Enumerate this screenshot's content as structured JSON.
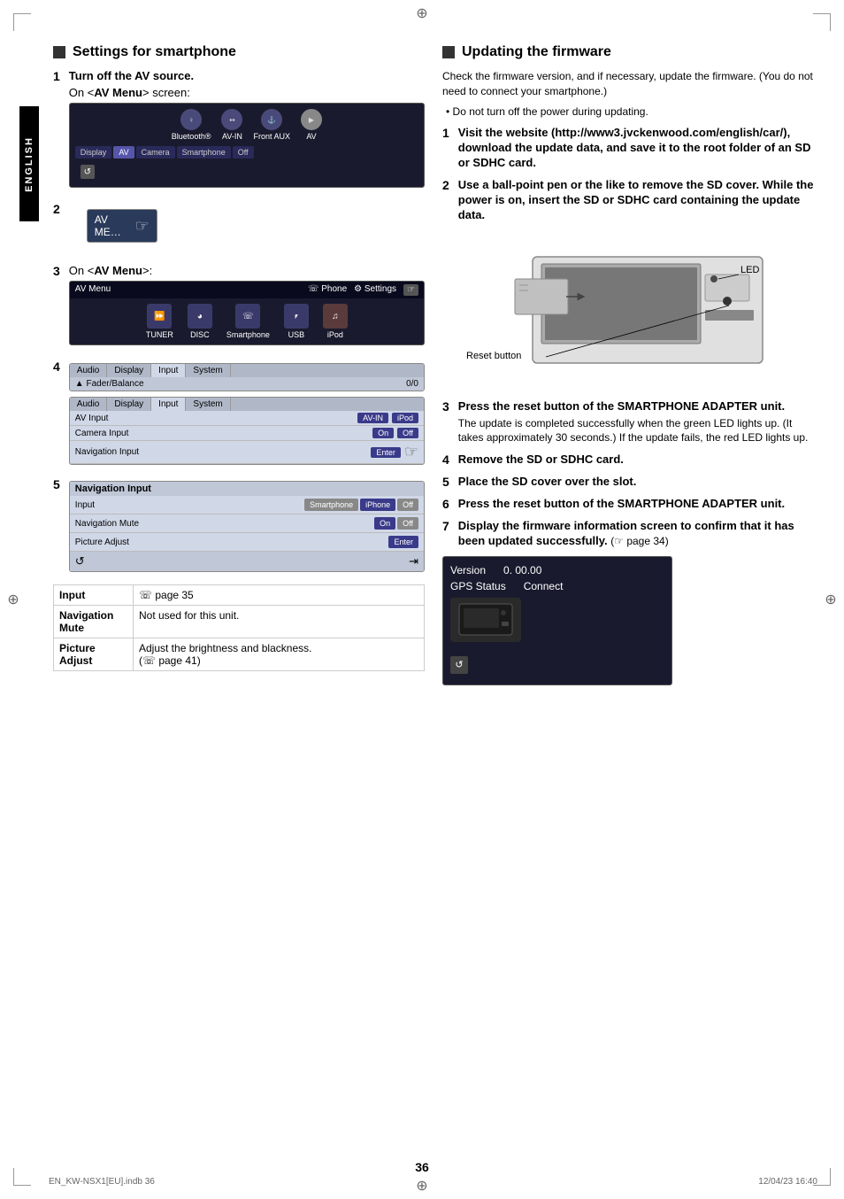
{
  "page": {
    "number": "36",
    "footer_left": "EN_KW-NSX1[EU].indb   36",
    "footer_right": "12/04/23   16:40",
    "language": "ENGLISH"
  },
  "left_section": {
    "title": "Settings for smartphone",
    "step1": {
      "num": "1",
      "text": "Turn off the AV source.",
      "sub": "On <AV Menu> screen:"
    },
    "step2": {
      "num": "2"
    },
    "step3": {
      "num": "3",
      "text": "On <AV Menu>:"
    },
    "step4": {
      "num": "4"
    },
    "step5": {
      "num": "5"
    },
    "av_source_screen": {
      "icons": [
        "Bluetooth®",
        "AV-IN",
        "Front AUX",
        "AV"
      ],
      "tabs": [
        "Display",
        "AV",
        "Camera",
        "Smartphone",
        "Off"
      ],
      "active_tab": "AV"
    },
    "av_menu_button": "AV ME…",
    "av_menu_screen": {
      "title": "AV Menu",
      "phone_label": "Phone",
      "settings_label": "Settings",
      "items": [
        "TUNER",
        "DISC",
        "Smartphone",
        "USB",
        "iPod"
      ]
    },
    "settings_screen1": {
      "tabs": [
        "Audio",
        "Display",
        "Input",
        "System"
      ],
      "header_label": "Fader/Balance",
      "header_value": "0/0"
    },
    "settings_screen2": {
      "tabs": [
        "Audio",
        "Display",
        "Input",
        "System"
      ],
      "rows": [
        {
          "label": "AV Input",
          "value": "AV-IN",
          "alt_value": "iPod"
        },
        {
          "label": "Camera Input",
          "value": "On",
          "alt_value": "Off"
        },
        {
          "label": "Navigation Input",
          "value": "",
          "btn": "Enter"
        }
      ]
    },
    "nav_input_screen": {
      "title": "Navigation Input",
      "rows": [
        {
          "label": "Input",
          "options": [
            "Smartphone",
            "iPhone",
            "Off"
          ]
        },
        {
          "label": "Navigation Mute",
          "options": [
            "On",
            "Off"
          ]
        },
        {
          "label": "Picture Adjust",
          "btn": "Enter"
        }
      ]
    },
    "info_table": {
      "rows": [
        {
          "key": "Input",
          "value": "☞ page 35"
        },
        {
          "key": "Navigation\nMute",
          "value": "Not used for this unit."
        },
        {
          "key": "Picture\nAdjust",
          "value": "Adjust the brightness and blackness.\n(☞ page 41)"
        }
      ]
    }
  },
  "right_section": {
    "title": "Updating the firmware",
    "intro": "Check the firmware version, and if necessary, update the firmware. (You do not need to connect your smartphone.)",
    "bullet": "Do not turn off the power during updating.",
    "step1": {
      "num": "1",
      "text": "Visit the website (http://www3.jvckenwood.com/english/car/), download the update data, and save it to the root folder of an SD or SDHC card."
    },
    "step2": {
      "num": "2",
      "text": "Use a ball-point pen or the like to remove the SD cover. While the power is on, insert the SD or SDHC card containing the update data."
    },
    "led_label": "LED",
    "reset_label": "Reset button",
    "step3": {
      "num": "3",
      "bold": "Press the reset button of the SMARTPHONE ADAPTER unit.",
      "desc": "The update is completed successfully when the green LED lights up. (It takes approximately 30 seconds.) If the update fails, the red LED lights up."
    },
    "step4": {
      "num": "4",
      "text": "Remove the SD or SDHC card."
    },
    "step5": {
      "num": "5",
      "text": "Place the SD cover over the slot."
    },
    "step6": {
      "num": "6",
      "bold": "Press the reset button of the SMARTPHONE ADAPTER unit."
    },
    "step7": {
      "num": "7",
      "bold": "Display the firmware information screen to confirm that it has been updated successfully.",
      "desc": "(☞ page 34)"
    },
    "version_screen": {
      "version_label": "Version",
      "version_value": "0. 00.00",
      "gps_label": "GPS Status",
      "gps_value": "Connect"
    }
  }
}
